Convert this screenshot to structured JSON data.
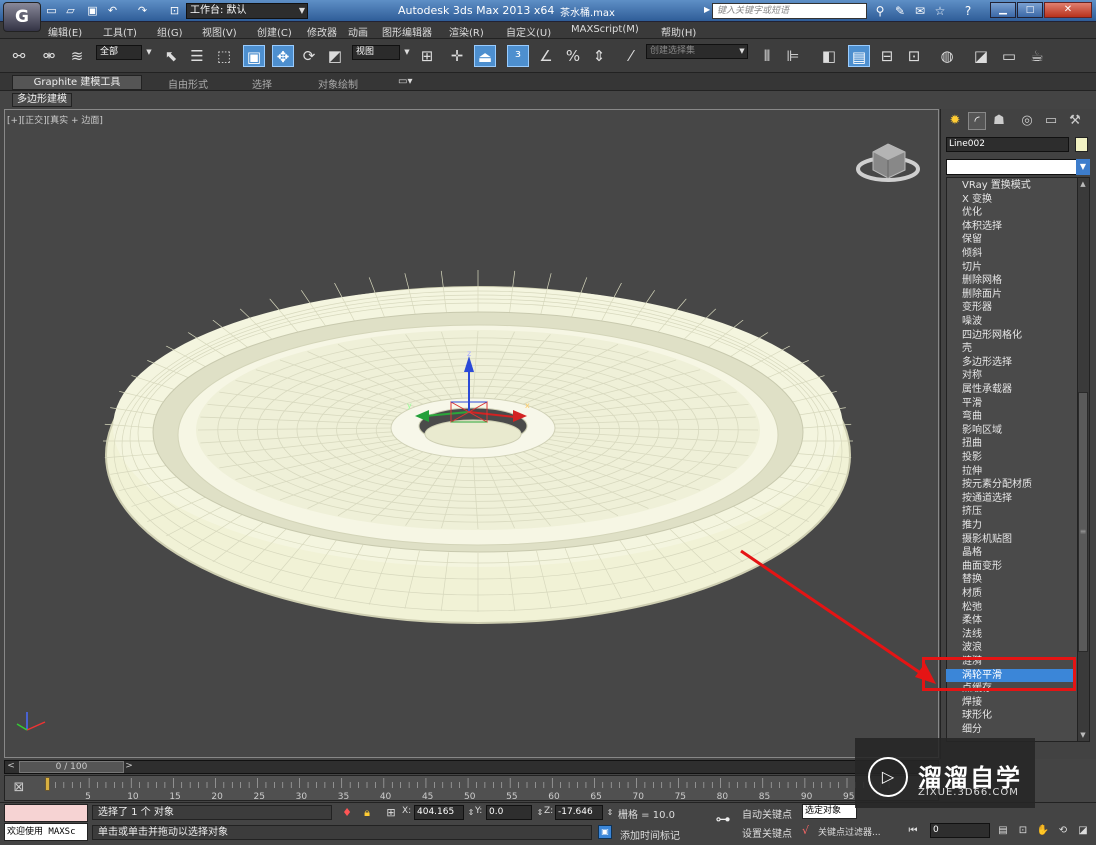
{
  "titlebar": {
    "workspace_label": "工作台: 默认",
    "app_title": "Autodesk 3ds Max  2013 x64",
    "file_name": "茶水桶.max",
    "help_placeholder": "键入关键字或短语",
    "logo": "G"
  },
  "menu": [
    "编辑(E)",
    "工具(T)",
    "组(G)",
    "视图(V)",
    "创建(C)",
    "修改器",
    "动画",
    "图形编辑器",
    "渲染(R)",
    "自定义(U)",
    "MAXScript(M)",
    "帮助(H)"
  ],
  "toolbar": {
    "filter_value": "全部",
    "refcoord_value": "视图",
    "selset_placeholder": "创建选择集"
  },
  "ribbon": {
    "tabs": [
      "Graphite 建模工具",
      "自由形式",
      "选择",
      "对象绘制"
    ],
    "subtab": "多边形建模"
  },
  "viewport": {
    "label": "[+][正交][真实 + 边面]",
    "object_color": "#f2f2c4"
  },
  "command_panel": {
    "object_name": "Line002",
    "object_color": "#f2f2c4",
    "modifier_list_value": "",
    "modifiers": [
      "VRay 置换模式",
      "X 变换",
      "优化",
      "体积选择",
      "保留",
      "倾斜",
      "切片",
      "删除网格",
      "删除面片",
      "变形器",
      "噪波",
      "四边形网格化",
      "壳",
      "多边形选择",
      "对称",
      "属性承载器",
      "平滑",
      "弯曲",
      "影响区域",
      "扭曲",
      "投影",
      "拉伸",
      "按元素分配材质",
      "按通道选择",
      "挤压",
      "推力",
      "摄影机贴图",
      "晶格",
      "曲面变形",
      "替换",
      "材质",
      "松弛",
      "柔体",
      "法线",
      "波浪",
      "涟漪",
      "涡轮平滑",
      "点缓存",
      "焊接",
      "球形化",
      "细分"
    ],
    "selected_modifier": "涡轮平滑",
    "highlight_color": "#e51414"
  },
  "timeline": {
    "position": "0 / 100",
    "ticks": [
      "5",
      "10",
      "15",
      "20",
      "25",
      "30",
      "35",
      "40",
      "45",
      "50",
      "55",
      "60",
      "65",
      "70",
      "75",
      "80",
      "85",
      "90",
      "95"
    ]
  },
  "status": {
    "welcome": "欢迎使用 MAXSc",
    "selection": "选择了 1 个 对象",
    "prompt": "单击或单击并拖动以选择对象",
    "x_label": "X:",
    "x_value": "404.165",
    "y_label": "Y:",
    "y_value": "0.0",
    "z_label": "Z:",
    "z_value": "-17.646",
    "grid": "栅格 = 10.0",
    "add_time_tag": "添加时间标记",
    "auto_key": "自动关键点",
    "set_key": "设置关键点",
    "selected_object": "选定对象",
    "key_filters": "关键点过滤器...",
    "frame": "0"
  },
  "watermark": {
    "title": "溜溜自学",
    "subtitle": "ZIXUE.3D66.COM"
  }
}
